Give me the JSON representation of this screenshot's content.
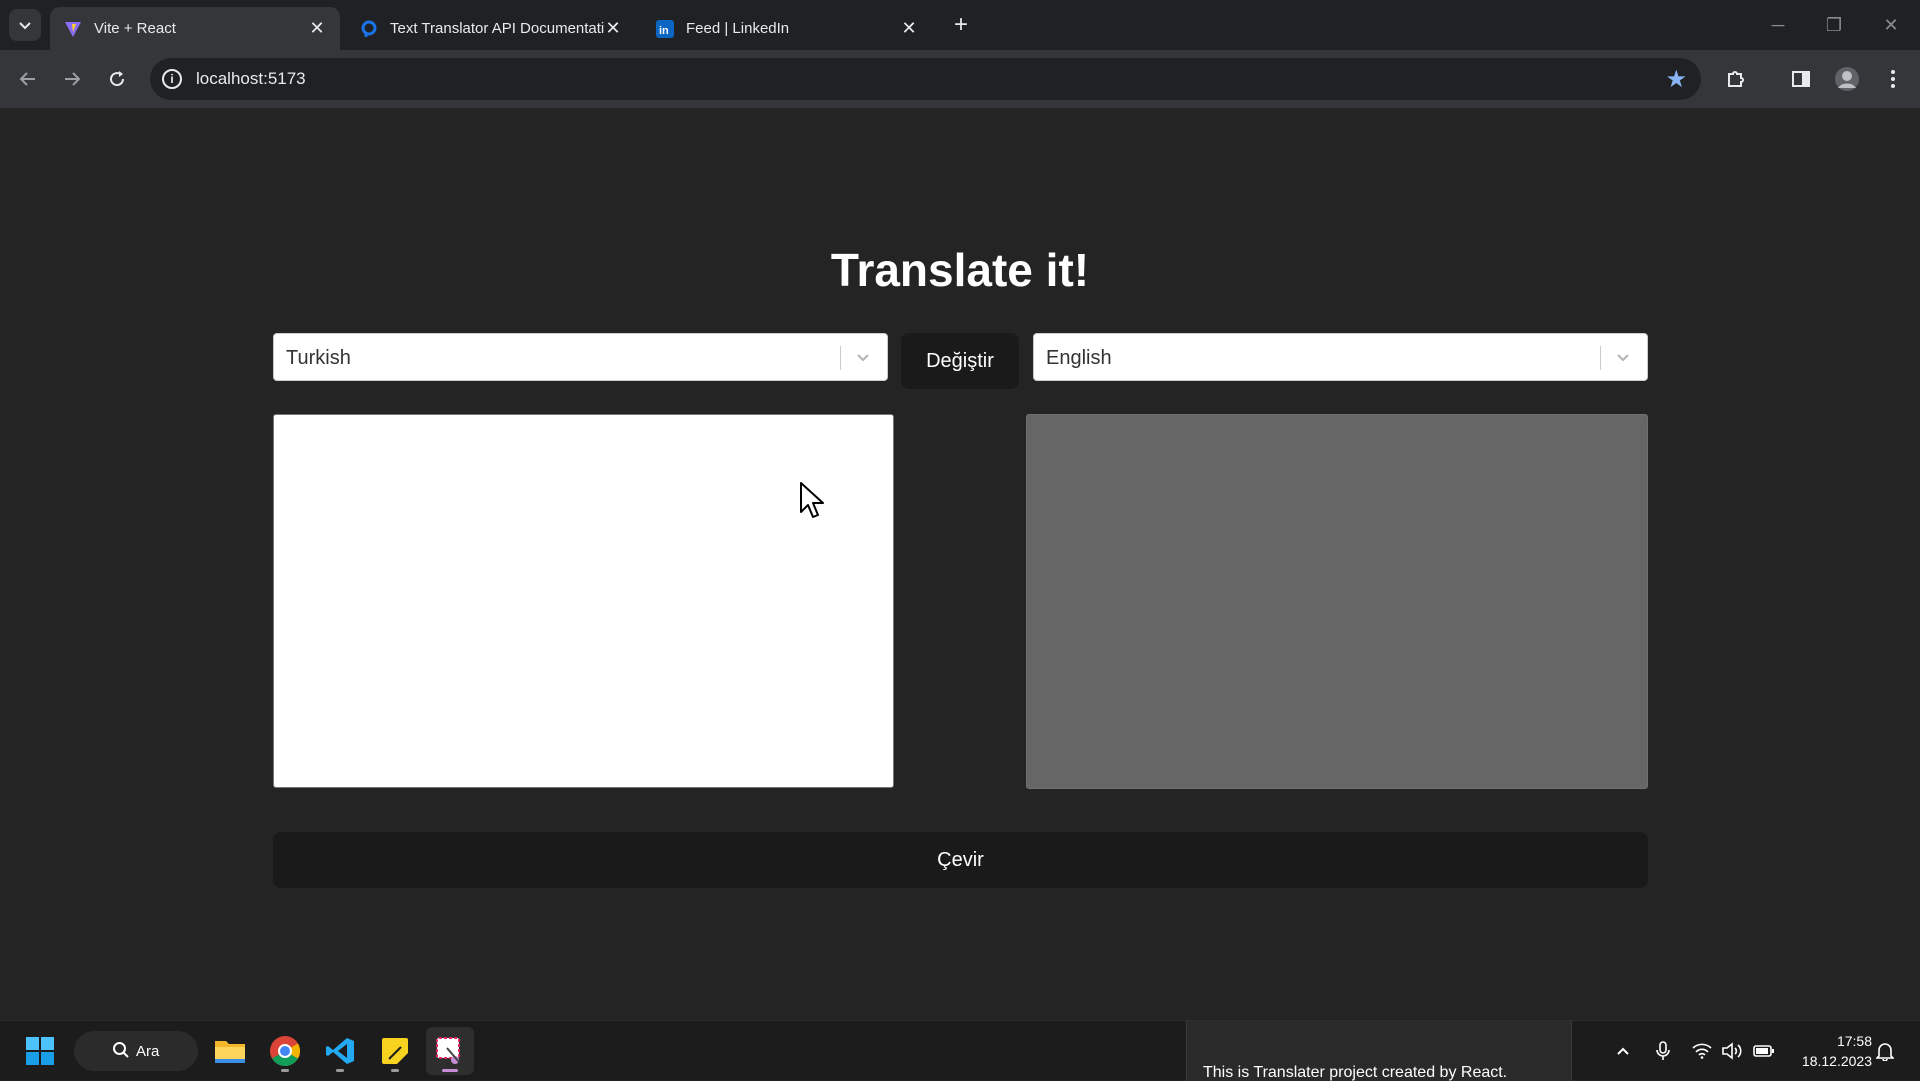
{
  "browser": {
    "tabs": [
      {
        "title": "Vite + React",
        "favicon": "vite-logo-icon",
        "active": true
      },
      {
        "title": "Text Translator API Documentati",
        "favicon": "rapidapi-logo-icon",
        "active": false
      },
      {
        "title": "Feed | LinkedIn",
        "favicon": "linkedin-logo-icon",
        "active": false
      }
    ],
    "url": "localhost:5173"
  },
  "app": {
    "heading": "Translate it!",
    "source_language": "Turkish",
    "target_language": "English",
    "swap_label": "Değiştir",
    "translate_label": "Çevir",
    "source_text": "",
    "result_text": ""
  },
  "taskbar": {
    "search_label": "Ara",
    "preview_text": "This is Translater project created by React.",
    "time": "17:58",
    "date": "18.12.2023"
  },
  "colors": {
    "page_background": "#242424",
    "button_background": "#1a1a1a",
    "result_background": "#666666",
    "active_app_indicator": "#c88cd6"
  }
}
